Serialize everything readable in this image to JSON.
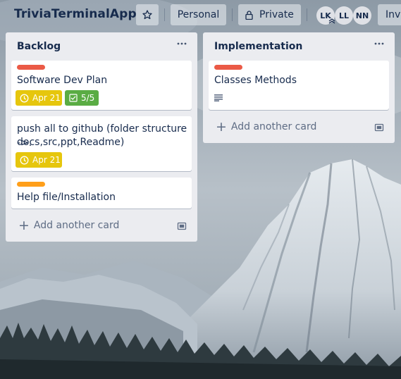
{
  "board": {
    "title": "TriviaTerminalApp",
    "star_icon": "star-icon",
    "visibility_team": "Personal",
    "visibility_privacy": "Private",
    "privacy_icon": "lock-icon",
    "members": [
      "LK",
      "LL",
      "NN"
    ],
    "invite_label": "Invi"
  },
  "lists": [
    {
      "title": "Backlog",
      "cards": [
        {
          "label_color": "#eb5a46",
          "title": "Software Dev Plan",
          "due": "Apr 21",
          "checklist": "5/5"
        },
        {
          "title": "push all to github (folder structure ->.",
          "title_line2": "docs,src,ppt,Readme)",
          "due": "Apr 21"
        },
        {
          "label_color": "#ff9f1a",
          "title": "Help file/Installation"
        }
      ],
      "add_card_label": "Add another card"
    },
    {
      "title": "Implementation",
      "cards": [
        {
          "label_color": "#eb5a46",
          "title": "Classes Methods",
          "has_description": true
        }
      ],
      "add_card_label": "Add another card"
    }
  ],
  "colors": {
    "list_bg": "#ebecf0",
    "due_badge": "#e6c60d",
    "checklist_badge": "#5aac44",
    "text": "#172b4d",
    "muted_text": "#5e6c84"
  }
}
